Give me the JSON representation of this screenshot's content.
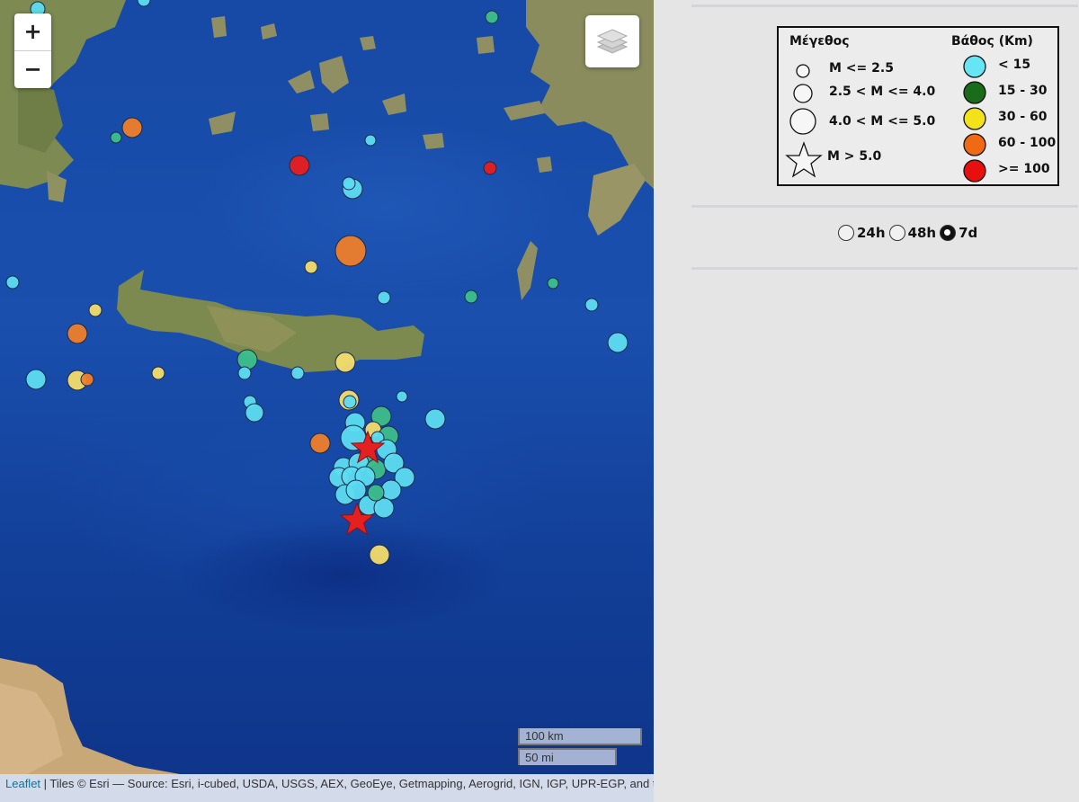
{
  "map": {
    "zoom_in_label": "+",
    "zoom_out_label": "−",
    "layers_icon": "layers-icon",
    "scale_km": "100 km",
    "scale_mi": "50 mi",
    "attribution_link": "Leaflet",
    "attribution_text": " | Tiles © Esri — Source: Esri, i-cubed, USDA, USGS, AEX, GeoEye, Getmapping, Aerogrid, IGN, IGP, UPR-EGP, and the GIS User Community",
    "colors": {
      "lt15": "#5ddcf0",
      "d15_30": "#3cbf8a",
      "d30_60": "#f3dc6b",
      "d60_100": "#ee7e2a",
      "gte100": "#e81d1d",
      "star": "#e52020"
    }
  },
  "legend": {
    "magnitude_title": "Μέγεθος",
    "depth_title": "Βάθος (Km)",
    "magnitude": [
      "M <= 2.5",
      "2.5 < M <= 4.0",
      "4.0 < M <= 5.0",
      "M > 5.0"
    ],
    "depth": [
      {
        "label": "< 15",
        "color": "#66e6f5"
      },
      {
        "label": "15 - 30",
        "color": "#1a6b1a"
      },
      {
        "label": "30 - 60",
        "color": "#f3e21a"
      },
      {
        "label": "60 - 100",
        "color": "#f06a14"
      },
      {
        "label": ">= 100",
        "color": "#e80f0f"
      }
    ]
  },
  "period": {
    "options": [
      "24h",
      "48h",
      "7d"
    ],
    "selected": "7d"
  }
}
